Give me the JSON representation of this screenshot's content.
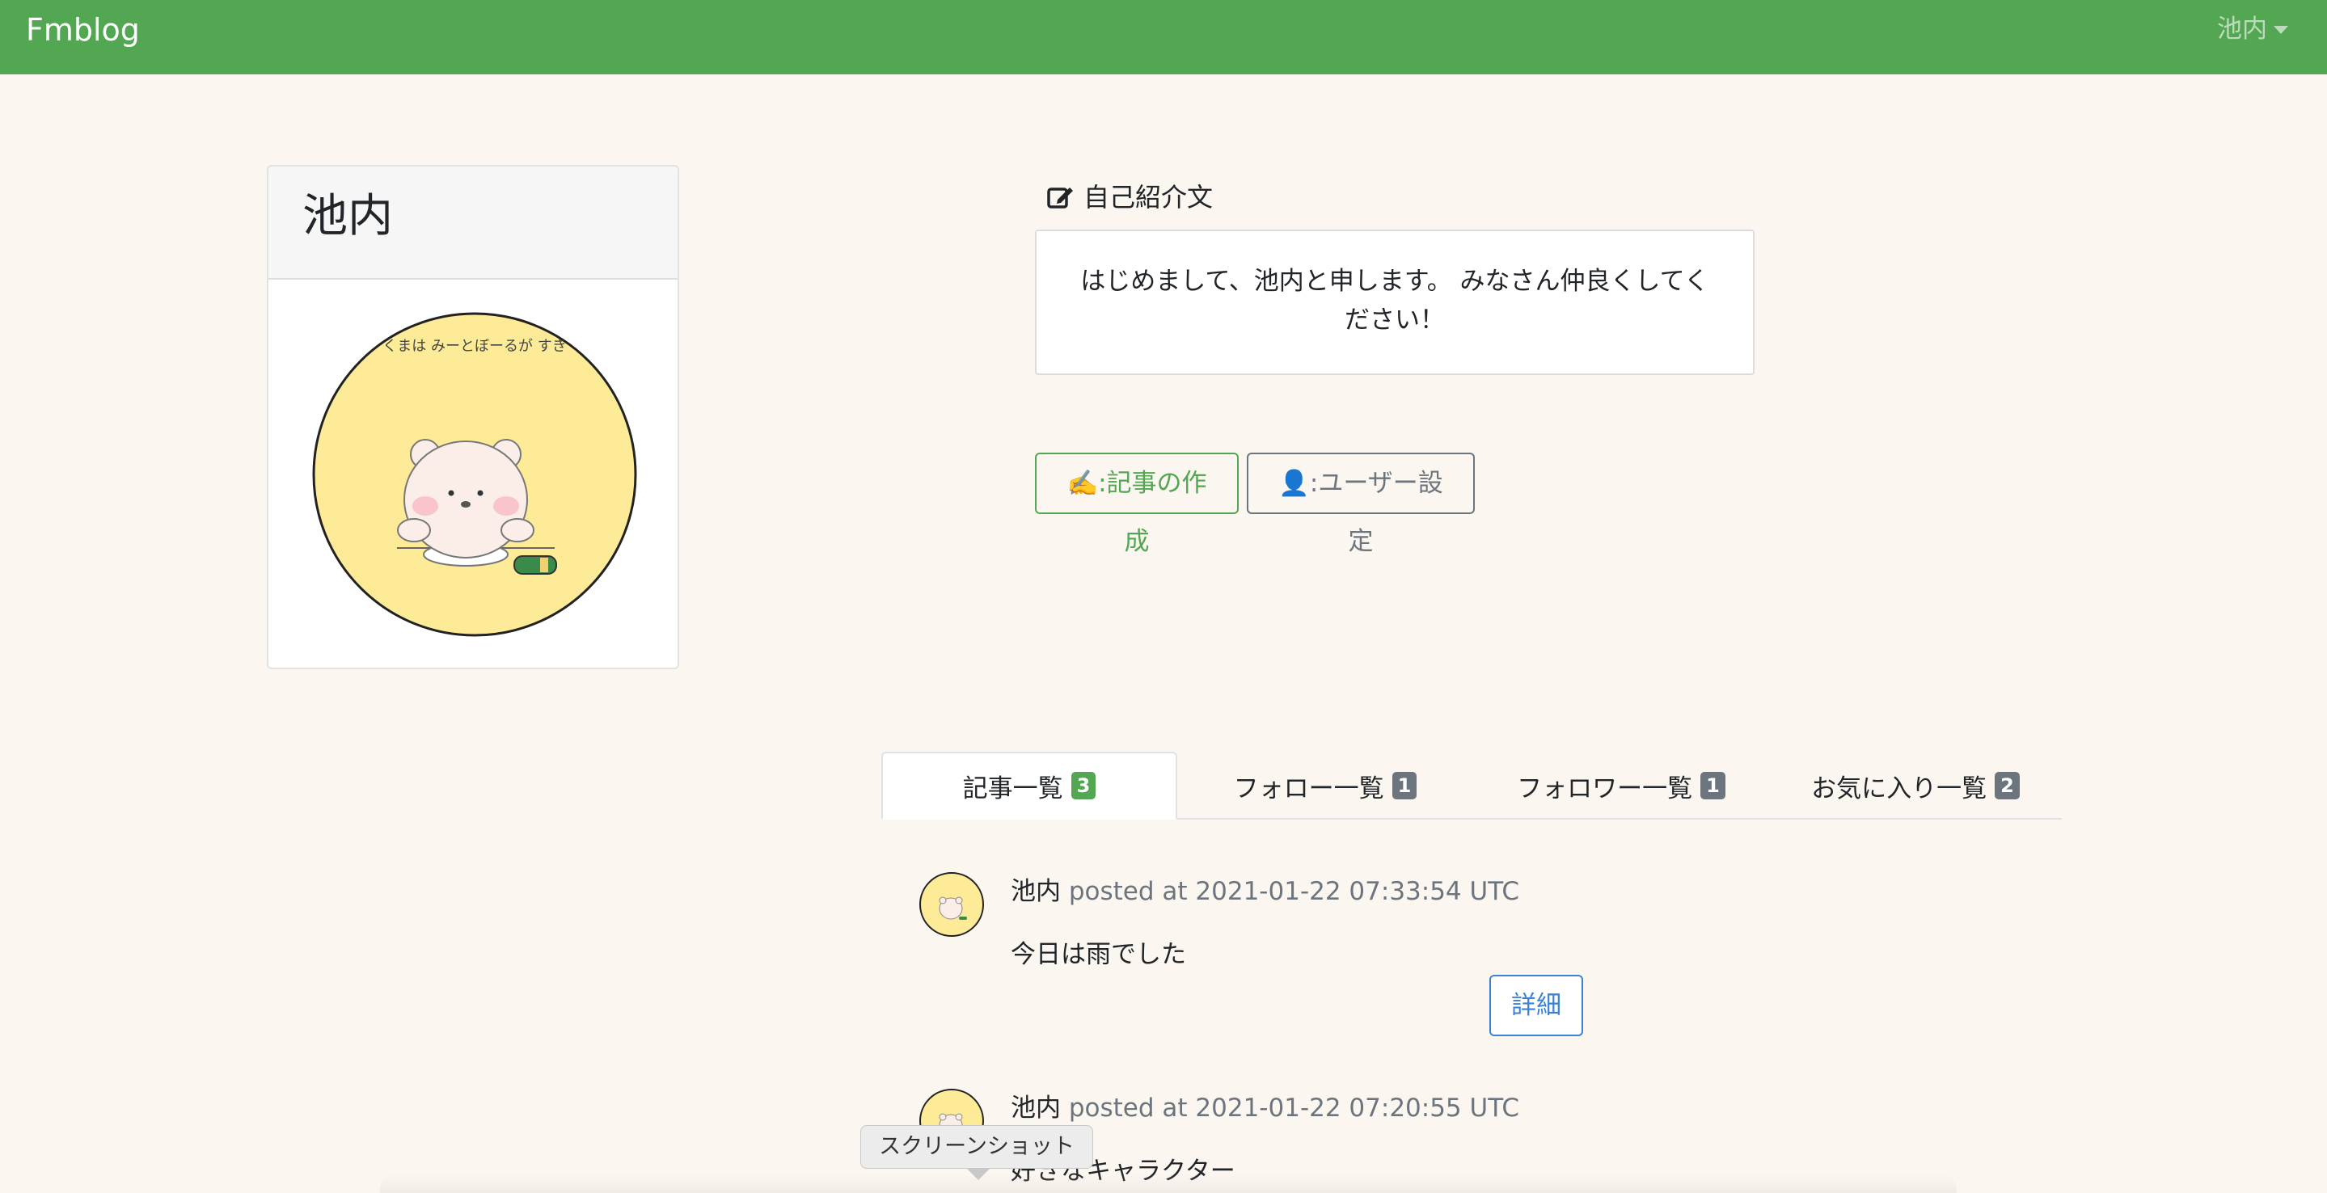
{
  "navbar": {
    "brand": "Fmblog",
    "user_menu_label": "池内",
    "background": "#53a753"
  },
  "profile": {
    "name": "池内",
    "avatar_icon": "bear-avatar-icon",
    "avatar_caption": "くまは みーとぼーるが すき"
  },
  "bio": {
    "heading": "自己紹介文",
    "heading_icon": "edit-icon",
    "text": "はじめまして、池内と申します。 みなさん仲良くしてください！"
  },
  "actions": {
    "create_label": "✍️:記事の作成",
    "settings_label": "👤:ユーザー設定"
  },
  "tabs": [
    {
      "label": "記事一覧",
      "count": "3",
      "active": true
    },
    {
      "label": "フォロー一覧",
      "count": "1",
      "active": false
    },
    {
      "label": "フォロワー一覧",
      "count": "1",
      "active": false
    },
    {
      "label": "お気に入り一覧",
      "count": "2",
      "active": false
    }
  ],
  "posts": [
    {
      "user": "池内",
      "meta": "posted at 2021-01-22 07:33:54 UTC",
      "body": "今日は雨でした",
      "detail_label": "詳細"
    },
    {
      "user": "池内",
      "meta": "posted at 2021-01-22 07:20:55 UTC",
      "body": "好きなキャラクター"
    }
  ],
  "tooltip": {
    "text": "スクリーンショット"
  },
  "colors": {
    "accent": "#53a753",
    "page_background": "#fbf6f0",
    "link_blue": "#3b82d6",
    "secondary_gray": "#6c757d"
  }
}
